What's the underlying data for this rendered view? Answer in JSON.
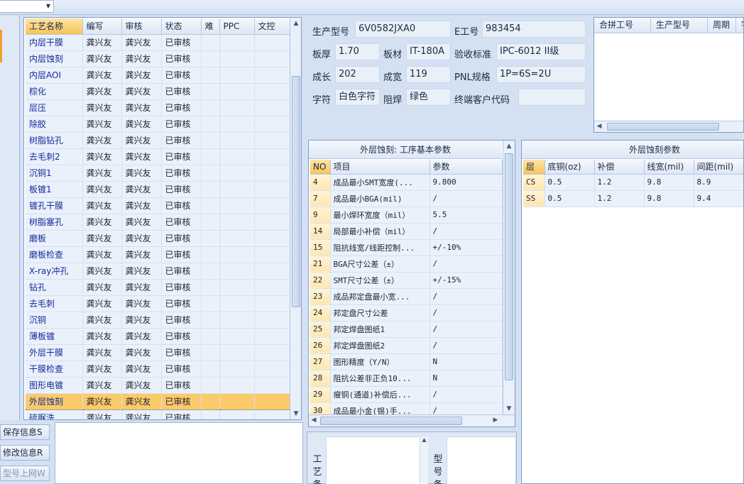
{
  "process_grid": {
    "headers": [
      "工艺名称",
      "编写",
      "审核",
      "状态",
      "难",
      "PPC",
      "文控"
    ],
    "rows": [
      {
        "name": "内层干膜",
        "writer": "龚兴友",
        "reviewer": "龚兴友",
        "status": "已审核"
      },
      {
        "name": "内层蚀刻",
        "writer": "龚兴友",
        "reviewer": "龚兴友",
        "status": "已审核"
      },
      {
        "name": "内层AOI",
        "writer": "龚兴友",
        "reviewer": "龚兴友",
        "status": "已审核"
      },
      {
        "name": "棕化",
        "writer": "龚兴友",
        "reviewer": "龚兴友",
        "status": "已审核"
      },
      {
        "name": "层压",
        "writer": "龚兴友",
        "reviewer": "龚兴友",
        "status": "已审核"
      },
      {
        "name": "除胶",
        "writer": "龚兴友",
        "reviewer": "龚兴友",
        "status": "已审核"
      },
      {
        "name": "树脂钻孔",
        "writer": "龚兴友",
        "reviewer": "龚兴友",
        "status": "已审核"
      },
      {
        "name": "去毛刺2",
        "writer": "龚兴友",
        "reviewer": "龚兴友",
        "status": "已审核"
      },
      {
        "name": "沉铜1",
        "writer": "龚兴友",
        "reviewer": "龚兴友",
        "status": "已审核"
      },
      {
        "name": "板镀1",
        "writer": "龚兴友",
        "reviewer": "龚兴友",
        "status": "已审核"
      },
      {
        "name": "镀孔干膜",
        "writer": "龚兴友",
        "reviewer": "龚兴友",
        "status": "已审核"
      },
      {
        "name": "树脂塞孔",
        "writer": "龚兴友",
        "reviewer": "龚兴友",
        "status": "已审核"
      },
      {
        "name": "磨板",
        "writer": "龚兴友",
        "reviewer": "龚兴友",
        "status": "已审核"
      },
      {
        "name": "磨板检查",
        "writer": "龚兴友",
        "reviewer": "龚兴友",
        "status": "已审核"
      },
      {
        "name": "X-ray冲孔",
        "writer": "龚兴友",
        "reviewer": "龚兴友",
        "status": "已审核"
      },
      {
        "name": "钻孔",
        "writer": "龚兴友",
        "reviewer": "龚兴友",
        "status": "已审核"
      },
      {
        "name": "去毛刺",
        "writer": "龚兴友",
        "reviewer": "龚兴友",
        "status": "已审核"
      },
      {
        "name": "沉铜",
        "writer": "龚兴友",
        "reviewer": "龚兴友",
        "status": "已审核"
      },
      {
        "name": "薄板镀",
        "writer": "龚兴友",
        "reviewer": "龚兴友",
        "status": "已审核"
      },
      {
        "name": "外层干膜",
        "writer": "龚兴友",
        "reviewer": "龚兴友",
        "status": "已审核"
      },
      {
        "name": "干膜检查",
        "writer": "龚兴友",
        "reviewer": "龚兴友",
        "status": "已审核"
      },
      {
        "name": "图形电镀",
        "writer": "龚兴友",
        "reviewer": "龚兴友",
        "status": "已审核"
      },
      {
        "name": "外层蚀刻",
        "writer": "龚兴友",
        "reviewer": "龚兴友",
        "status": "已审核",
        "selected": true
      },
      {
        "name": "硫脲洗",
        "writer": "龚兴友",
        "reviewer": "龚兴友",
        "status": "已审核"
      }
    ]
  },
  "side_buttons": {
    "save": "保存信息S",
    "modify": "修改信息R",
    "upload": "型号上网W"
  },
  "info": {
    "product_model_label": "生产型号",
    "product_model": "6V0582JXA0",
    "eng_no_label": "E工号",
    "eng_no": "983454",
    "thickness_label": "板厚",
    "thickness": "1.70",
    "material_label": "板材",
    "material": "IT-180A",
    "standard_label": "验收标准",
    "standard": "IPC-6012 II级",
    "length_label": "成长",
    "length": "202",
    "width_label": "成宽",
    "width": "119",
    "pnl_label": "PNL规格",
    "pnl": "1P=6S=2U",
    "silk_label": "字符",
    "silk": "白色字符",
    "mask_label": "阻焊",
    "mask": "绿色",
    "customer_label": "终端客户代码",
    "customer": ""
  },
  "merge_panel": {
    "headers": [
      "合拼工号",
      "生产型号",
      "周期",
      "字"
    ]
  },
  "params_panel": {
    "title": "外层蚀刻: 工序基本参数",
    "headers": [
      "NO",
      "项目",
      "参数"
    ],
    "rows": [
      {
        "no": "4",
        "item": "成品最小SMT宽度(...",
        "value": "9.800"
      },
      {
        "no": "7",
        "item": "成品最小BGA(mil)",
        "value": "/"
      },
      {
        "no": "9",
        "item": "最小焊环宽度（mil）",
        "value": "5.5"
      },
      {
        "no": "14",
        "item": "局部最小补偿（mil）",
        "value": "/"
      },
      {
        "no": "15",
        "item": "阻抗线宽/线距控制...",
        "value": "+/-10%"
      },
      {
        "no": "21",
        "item": "BGA尺寸公差（±）",
        "value": "/"
      },
      {
        "no": "22",
        "item": "SMT尺寸公差（±）",
        "value": "+/-15%"
      },
      {
        "no": "23",
        "item": "成品邦定盘最小宽...",
        "value": "/"
      },
      {
        "no": "24",
        "item": "邦定盘尺寸公差",
        "value": "/"
      },
      {
        "no": "25",
        "item": "邦定焊盘图纸1",
        "value": "/"
      },
      {
        "no": "26",
        "item": "邦定焊盘图纸2",
        "value": "/"
      },
      {
        "no": "27",
        "item": "图形精度（Y/N）",
        "value": "N"
      },
      {
        "no": "28",
        "item": "阻抗公差非正负10...",
        "value": "N"
      },
      {
        "no": "29",
        "item": "瘦铜(通道)补偿后...",
        "value": "/"
      },
      {
        "no": "30",
        "item": "成品最小金(锡)手...",
        "value": "/"
      }
    ]
  },
  "etch_panel": {
    "title": "外层蚀刻参数",
    "headers": [
      "层",
      "底铜(oz)",
      "补偿",
      "线宽(mil)",
      "间距(mil)"
    ],
    "rows": [
      {
        "layer": "CS",
        "copper": "0.5",
        "comp": "1.2",
        "width": "9.8",
        "spacing": "8.9"
      },
      {
        "layer": "SS",
        "copper": "0.5",
        "comp": "1.2",
        "width": "9.8",
        "spacing": "9.4"
      }
    ]
  },
  "bottom": {
    "process_label": "工艺备",
    "model_label": "型号备"
  },
  "colors": {
    "selected_row": "#fbca6a",
    "header_highlight": "#f7c45a",
    "cell_bg": "#eaf1fb",
    "panel_bg": "#d4e1f3"
  }
}
